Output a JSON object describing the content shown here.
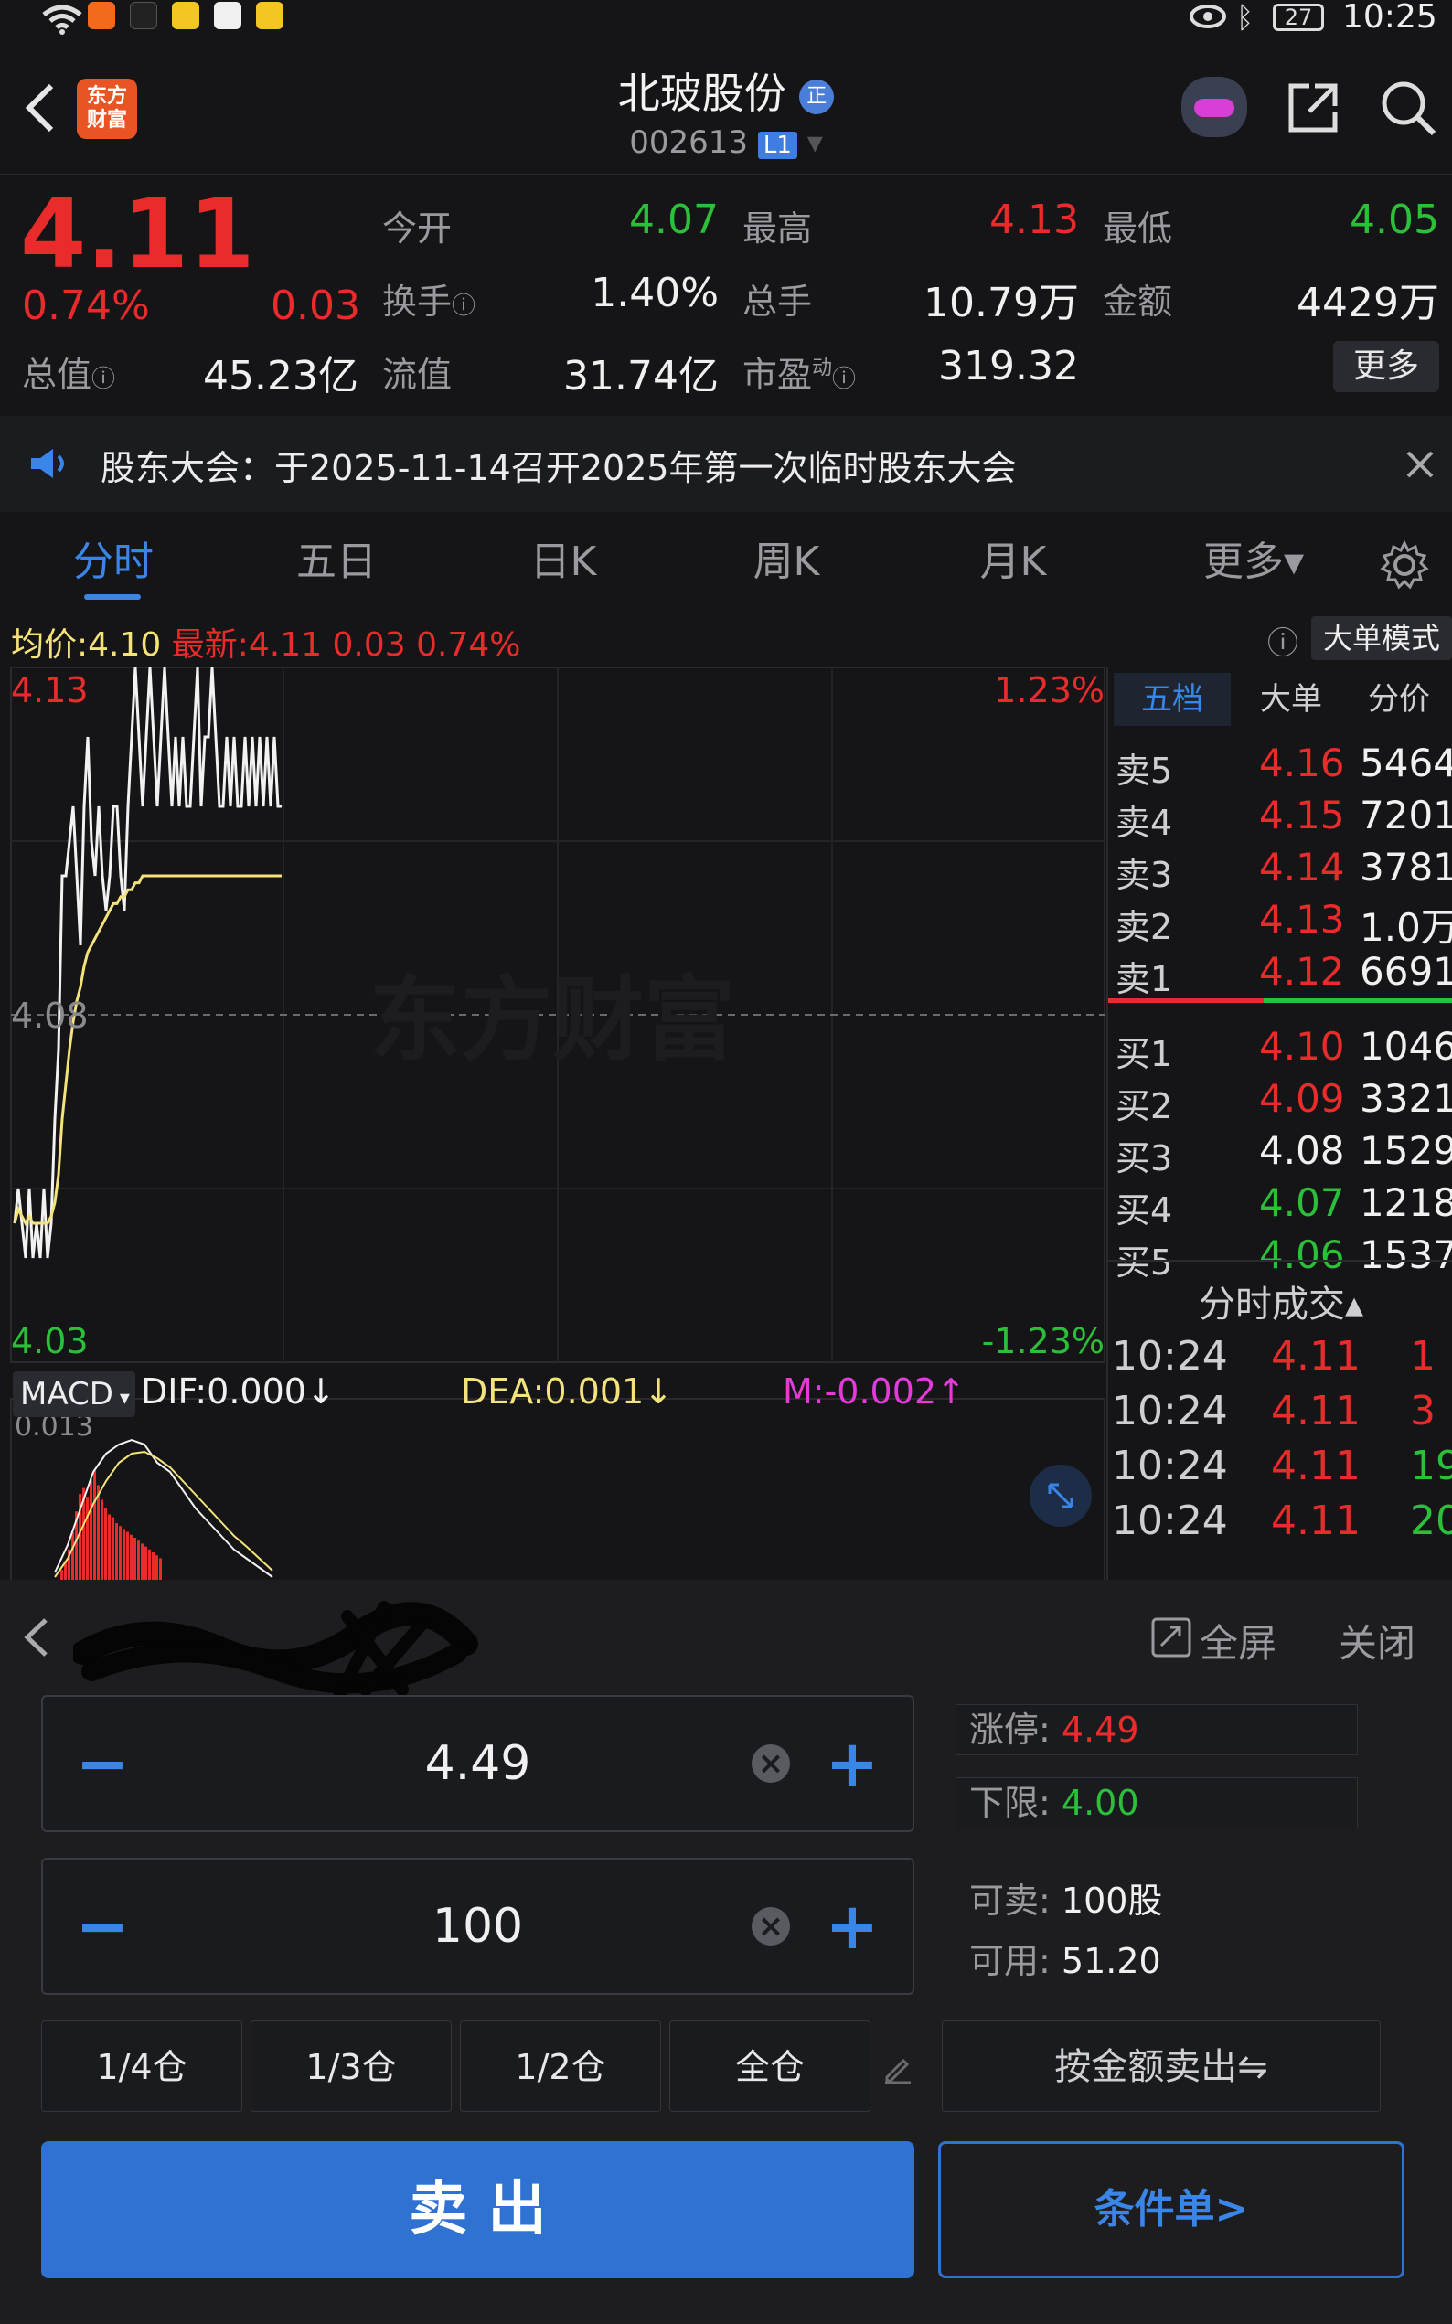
{
  "status_bar": {
    "time": "10:25",
    "battery": "27"
  },
  "header": {
    "app_logo_text": "东方\n财富",
    "stock_name": "北玻股份",
    "stock_code": "002613",
    "level_badge": "L1",
    "badge_icon": "正"
  },
  "quote": {
    "price": "4.11",
    "change_pct": "0.74%",
    "change": "0.03",
    "open_label": "今开",
    "open": "4.07",
    "high_label": "最高",
    "high": "4.13",
    "low_label": "最低",
    "low": "4.05",
    "turnover_label": "换手",
    "turnover": "1.40%",
    "volume_label": "总手",
    "volume": "10.79万",
    "amount_label": "金额",
    "amount": "4429万",
    "mcap_label": "总值",
    "mcap": "45.23亿",
    "float_label": "流值",
    "float": "31.74亿",
    "pe_label": "市盈",
    "pe_sup": "动",
    "pe": "319.32",
    "more_label": "更多"
  },
  "notice": {
    "text": "股东大会：于2025-11-14召开2025年第一次临时股东大会"
  },
  "tabs": [
    {
      "label": "分时",
      "active": true
    },
    {
      "label": "五日"
    },
    {
      "label": "日K"
    },
    {
      "label": "周K"
    },
    {
      "label": "月K"
    },
    {
      "label": "更多▾"
    }
  ],
  "chart_header": {
    "avg_label": "均价:",
    "avg": "4.10",
    "latest_label": "最新:",
    "latest": "4.11",
    "latest_chg": "0.03",
    "latest_pct": "0.74%",
    "big_order_label": "大单模式"
  },
  "chart_axis": {
    "top_price": "4.13",
    "mid_price": "4.08",
    "bottom_price": "4.03",
    "top_pct": "1.23%",
    "bottom_pct": "-1.23%",
    "watermark": "东方财富"
  },
  "chart_data": {
    "type": "line",
    "ylim": [
      4.03,
      4.13
    ],
    "pre_close": 4.08,
    "series": [
      {
        "values": [
          4.05,
          4.055,
          4.05,
          4.045,
          4.055,
          4.045,
          4.05,
          4.045,
          4.055,
          4.045,
          4.05,
          4.065,
          4.075,
          4.1,
          4.1,
          4.105,
          4.11,
          4.1,
          4.09,
          4.11,
          4.12,
          4.105,
          4.1,
          4.11,
          4.1,
          4.095,
          4.1,
          4.11,
          4.11,
          4.1,
          4.095,
          4.11,
          4.12,
          4.13,
          4.12,
          4.11,
          4.12,
          4.13,
          4.12,
          4.11,
          4.12,
          4.13,
          4.12,
          4.11,
          4.12,
          4.11,
          4.12,
          4.11,
          4.11,
          4.12,
          4.13,
          4.11,
          4.12,
          4.12,
          4.13,
          4.12,
          4.11,
          4.11,
          4.12,
          4.11,
          4.12,
          4.11,
          4.11,
          4.12,
          4.11,
          4.12,
          4.11,
          4.12,
          4.11,
          4.12,
          4.11,
          4.12,
          4.11,
          4.11
        ]
      },
      {
        "name": "均价",
        "values": [
          4.05,
          4.052,
          4.051,
          4.05,
          4.051,
          4.05,
          4.05,
          4.05,
          4.05,
          4.05,
          4.051,
          4.053,
          4.057,
          4.065,
          4.07,
          4.075,
          4.079,
          4.082,
          4.084,
          4.087,
          4.089,
          4.09,
          4.091,
          4.092,
          4.093,
          4.094,
          4.095,
          4.096,
          4.096,
          4.097,
          4.097,
          4.098,
          4.098,
          4.099,
          4.099,
          4.1,
          4.1,
          4.1,
          4.1,
          4.1,
          4.1,
          4.1,
          4.1,
          4.1,
          4.1,
          4.1,
          4.1,
          4.1,
          4.1,
          4.1,
          4.1,
          4.1,
          4.1,
          4.1,
          4.1,
          4.1,
          4.1,
          4.1,
          4.1,
          4.1,
          4.1,
          4.1,
          4.1,
          4.1,
          4.1,
          4.1,
          4.1,
          4.1,
          4.1,
          4.1,
          4.1,
          4.1,
          4.1,
          4.1
        ]
      }
    ]
  },
  "macd": {
    "selector": "MACD",
    "dif": "DIF:0.000↓",
    "dea": "DEA:0.001↓",
    "m": "M:-0.002↑",
    "top_value": "0.013"
  },
  "order_book_tabs": [
    {
      "label": "五档",
      "active": true
    },
    {
      "label": "大单"
    },
    {
      "label": "分价"
    }
  ],
  "order_book": {
    "asks": [
      {
        "label": "卖5",
        "price": "4.16",
        "vol": "5464",
        "color": "red"
      },
      {
        "label": "卖4",
        "price": "4.15",
        "vol": "7201",
        "color": "red"
      },
      {
        "label": "卖3",
        "price": "4.14",
        "vol": "3781",
        "color": "red"
      },
      {
        "label": "卖2",
        "price": "4.13",
        "vol": "1.0万",
        "color": "red"
      },
      {
        "label": "卖1",
        "price": "4.12",
        "vol": "6691",
        "color": "red"
      }
    ],
    "bids": [
      {
        "label": "买1",
        "price": "4.10",
        "vol": "1046",
        "color": "red"
      },
      {
        "label": "买2",
        "price": "4.09",
        "vol": "3321",
        "color": "red"
      },
      {
        "label": "买3",
        "price": "4.08",
        "vol": "1529",
        "color": "white"
      },
      {
        "label": "买4",
        "price": "4.07",
        "vol": "1218",
        "color": "green"
      },
      {
        "label": "买5",
        "price": "4.06",
        "vol": "1537",
        "color": "green"
      }
    ]
  },
  "trades_header": "分时成交▴",
  "trades": [
    {
      "time": "10:24",
      "price": "4.11",
      "vol": "1",
      "color": "red"
    },
    {
      "time": "10:24",
      "price": "4.11",
      "vol": "3",
      "color": "red"
    },
    {
      "time": "10:24",
      "price": "4.11",
      "vol": "19",
      "color": "green"
    },
    {
      "time": "10:24",
      "price": "4.11",
      "vol": "20",
      "color": "green"
    }
  ],
  "trade_panel": {
    "fullscreen_label": "全屏",
    "close_label": "关闭",
    "price_value": "4.49",
    "qty_value": "100",
    "limit_up_label": "涨停:",
    "limit_up": "4.49",
    "lower_label": "下限:",
    "lower": "4.00",
    "sellable_label": "可卖:",
    "sellable": "100股",
    "available_label": "可用:",
    "available": "51.20",
    "positions": [
      "1/4仓",
      "1/3仓",
      "1/2仓",
      "全仓"
    ],
    "by_amount_label": "按金额卖出⇋",
    "sell_label": "卖 出",
    "conditional_label": "条件单>"
  }
}
